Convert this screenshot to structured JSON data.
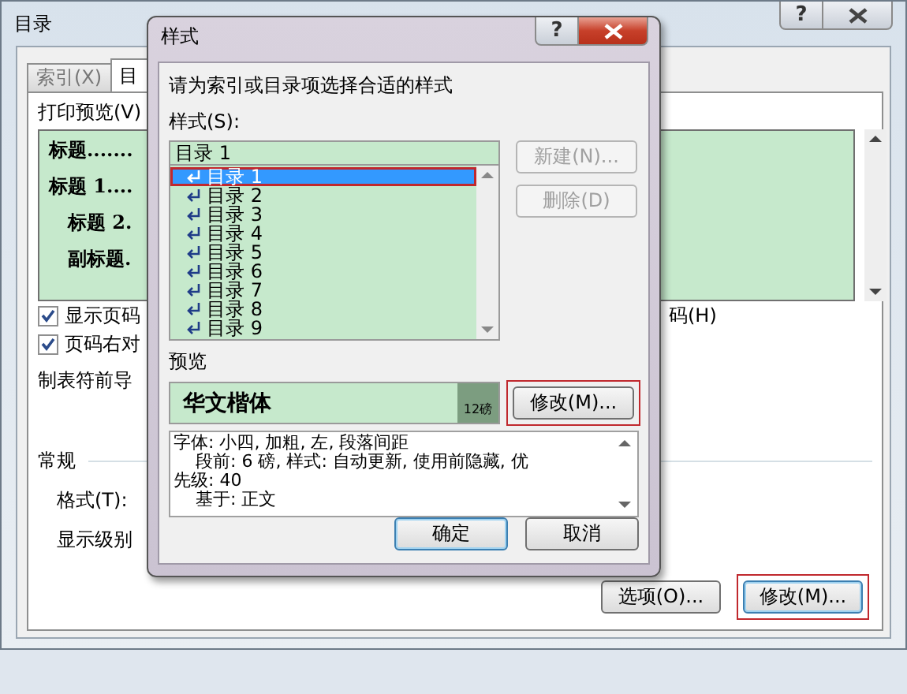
{
  "back_window": {
    "title": "目录",
    "help_glyph": "?",
    "tabs": [
      {
        "label": "索引(X)",
        "selected": false
      },
      {
        "label": "目",
        "selected": true
      }
    ],
    "print_preview": {
      "label": "打印预览(V)",
      "lines": [
        "标题.......",
        "标题 1....",
        "标题 2.",
        "副标题."
      ]
    },
    "checkboxes": [
      {
        "label": "显示页码",
        "checked": true
      },
      {
        "label": "页码右对",
        "checked": true
      }
    ],
    "right_option_tail": "码(H)",
    "tab_leader_label": "制表符前导",
    "general": {
      "heading": "常规",
      "format_label": "格式(T):",
      "level_label": "显示级别"
    },
    "buttons": [
      {
        "label": "选项(O)...",
        "highlighted": false
      },
      {
        "label": "修改(M)...",
        "highlighted": true
      }
    ]
  },
  "front_window": {
    "title": "样式",
    "help_glyph": "?",
    "prompt": "请为索引或目录项选择合适的样式",
    "styles_label": "样式(S):",
    "style_field": "目录 1",
    "style_list": [
      {
        "label": "目录 1",
        "selected": true,
        "highlighted": true
      },
      {
        "label": "目录 2",
        "selected": false,
        "highlighted": false
      },
      {
        "label": "目录 3",
        "selected": false,
        "highlighted": false
      },
      {
        "label": "目录 4",
        "selected": false,
        "highlighted": false
      },
      {
        "label": "目录 5",
        "selected": false,
        "highlighted": false
      },
      {
        "label": "目录 6",
        "selected": false,
        "highlighted": false
      },
      {
        "label": "目录 7",
        "selected": false,
        "highlighted": false
      },
      {
        "label": "目录 8",
        "selected": false,
        "highlighted": false
      },
      {
        "label": "目录 9",
        "selected": false,
        "highlighted": false
      }
    ],
    "side_buttons": [
      {
        "label": "新建(N)...",
        "disabled": true
      },
      {
        "label": "删除(D)",
        "disabled": true
      }
    ],
    "preview_label": "预览",
    "preview_text": "华文楷体",
    "preview_size": "12磅",
    "modify_button": {
      "label": "修改(M)...",
      "highlighted": true
    },
    "description": [
      "字体: 小四, 加粗, 左, 段落间距",
      "段前: 6 磅, 样式: 自动更新, 使用前隐藏, 优",
      "先级: 40",
      "基于: 正文"
    ],
    "buttons": [
      {
        "label": "确定",
        "default": true
      },
      {
        "label": "取消",
        "default": false
      }
    ]
  }
}
